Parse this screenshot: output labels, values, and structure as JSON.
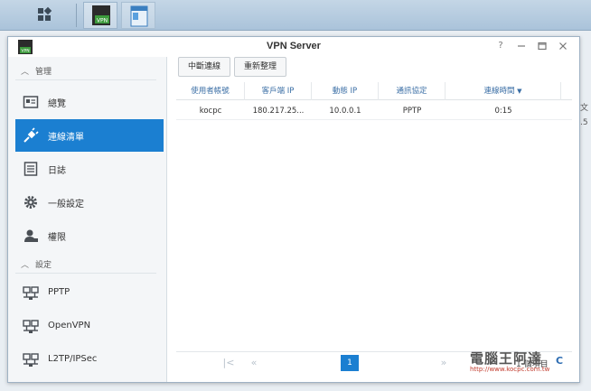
{
  "window": {
    "title": "VPN Server",
    "app_icon_label": "VPN"
  },
  "taskbar": {
    "vpn_label": "VPN"
  },
  "sidebar": {
    "sections": [
      {
        "label": "管理"
      },
      {
        "label": "設定"
      }
    ],
    "items": [
      {
        "label": "總覽",
        "icon": "overview-icon"
      },
      {
        "label": "連線清單",
        "icon": "connection-plug-icon",
        "active": true
      },
      {
        "label": "日誌",
        "icon": "log-icon"
      },
      {
        "label": "一般設定",
        "icon": "gear-icon"
      },
      {
        "label": "權限",
        "icon": "user-icon"
      },
      {
        "label": "PPTP",
        "icon": "network-icon"
      },
      {
        "label": "OpenVPN",
        "icon": "network-icon"
      },
      {
        "label": "L2TP/IPSec",
        "icon": "network-icon"
      }
    ]
  },
  "toolbar": {
    "disconnect_label": "中斷連線",
    "refresh_label": "重新整理"
  },
  "table": {
    "columns": [
      "使用者帳號",
      "客戶端 IP",
      "動態 IP",
      "通訊協定",
      "連線時間"
    ],
    "rows": [
      [
        "kocpc",
        "180.217.25...",
        "10.0.0.1",
        "PPTP",
        "0:15"
      ]
    ]
  },
  "pager": {
    "current_page": "1",
    "count_text": "1 個項目"
  },
  "side_strip": {
    "line1": "文",
    "line2": ".5"
  },
  "watermark": {
    "main": "電腦王阿達",
    "sub": "http://www.kocpc.com.tw"
  },
  "colors": {
    "accent": "#1b7fd1",
    "header_text": "#3a6ea5"
  }
}
